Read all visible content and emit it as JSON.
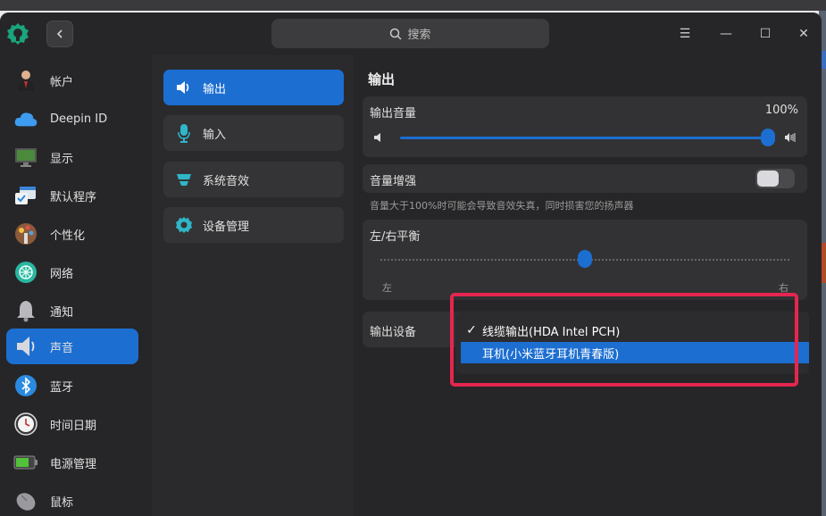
{
  "titlebar": {
    "search_placeholder": "搜索",
    "menu_glyph": "☰",
    "minimize_glyph": "—",
    "maximize_glyph": "☐",
    "close_glyph": "✕"
  },
  "sidebar": {
    "items": [
      {
        "label": "帐户",
        "icon": "account-icon"
      },
      {
        "label": "Deepin ID",
        "icon": "cloud-icon"
      },
      {
        "label": "显示",
        "icon": "display-icon"
      },
      {
        "label": "默认程序",
        "icon": "default-apps-icon"
      },
      {
        "label": "个性化",
        "icon": "personalization-icon"
      },
      {
        "label": "网络",
        "icon": "network-icon"
      },
      {
        "label": "通知",
        "icon": "bell-icon"
      },
      {
        "label": "声音",
        "icon": "speaker-icon",
        "active": true
      },
      {
        "label": "蓝牙",
        "icon": "bluetooth-icon"
      },
      {
        "label": "时间日期",
        "icon": "clock-icon"
      },
      {
        "label": "电源管理",
        "icon": "battery-icon"
      },
      {
        "label": "鼠标",
        "icon": "mouse-icon"
      }
    ]
  },
  "subnav": {
    "items": [
      {
        "label": "输出",
        "icon": "speaker-output-icon",
        "active": true
      },
      {
        "label": "输入",
        "icon": "microphone-icon"
      },
      {
        "label": "系统音效",
        "icon": "sound-effects-icon"
      },
      {
        "label": "设备管理",
        "icon": "gear-icon"
      }
    ]
  },
  "output": {
    "title": "输出",
    "volume_label": "输出音量",
    "volume_value": "100%",
    "volume_level": 1.0,
    "boost_label": "音量增强",
    "boost_on": false,
    "boost_hint": "音量大于100%时可能会导致音效失真，同时损害您的扬声器",
    "balance_label": "左/右平衡",
    "balance_left": "左",
    "balance_right": "右",
    "balance_level": 0.5,
    "device_label": "输出设备",
    "device_options": [
      {
        "label": "线缆输出(HDA Intel PCH)",
        "checked": true
      },
      {
        "label": "耳机(小米蓝牙耳机青春版)",
        "highlighted": true
      }
    ]
  },
  "colors": {
    "accent": "#1c6ed1",
    "annotation": "#e5264f"
  }
}
